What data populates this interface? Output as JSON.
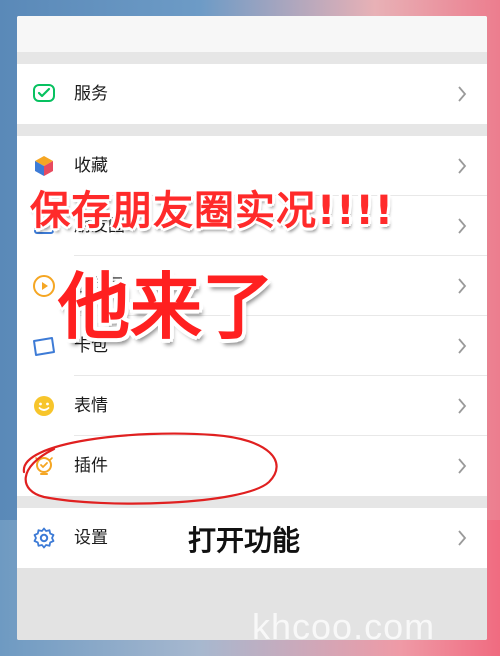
{
  "menu": {
    "items": [
      {
        "label": "服务",
        "icon": "wechat-pay-icon"
      },
      {
        "label": "收藏",
        "icon": "favorites-cube-icon"
      },
      {
        "label": "朋友圈",
        "icon": "moments-icon"
      },
      {
        "label": "视频号",
        "icon": "video-icon"
      },
      {
        "label": "卡包",
        "icon": "card-wallet-icon"
      },
      {
        "label": "表情",
        "icon": "sticker-smiley-icon"
      },
      {
        "label": "插件",
        "icon": "plugin-bulb-icon"
      },
      {
        "label": "设置",
        "icon": "settings-gear-icon"
      }
    ]
  },
  "overlay": {
    "title": "保存朋友圈实况!!!!",
    "subtitle": "他来了",
    "caption": "打开功能"
  },
  "watermark": "khcoo.com",
  "colors": {
    "accent_green": "#07c160",
    "overlay_red": "#ff2a2a",
    "icon_blue": "#3d7bd6",
    "icon_orange": "#f5a623",
    "icon_yellow": "#f7c52b"
  }
}
